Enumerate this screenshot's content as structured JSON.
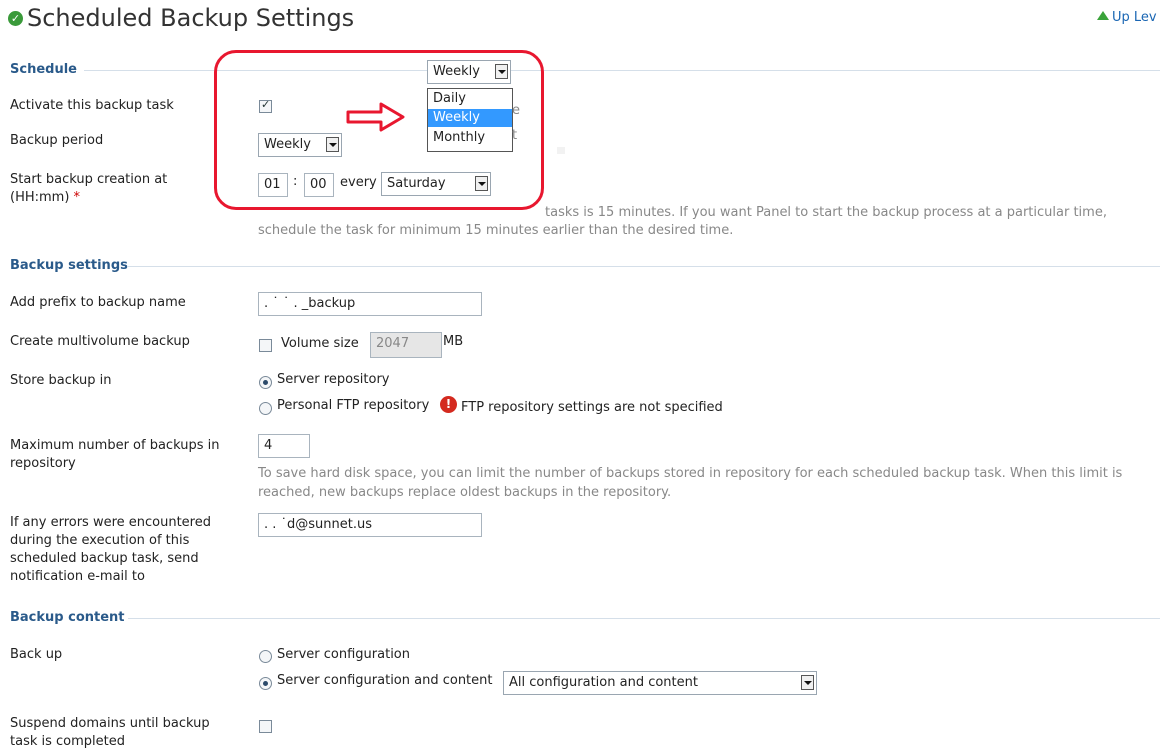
{
  "header": {
    "title": "Scheduled Backup Settings",
    "up_level": "Up Lev"
  },
  "schedule": {
    "section_title": "Schedule",
    "activate_label": "Activate this backup task",
    "activate_checked": true,
    "period_label": "Backup period",
    "period_value": "Weekly",
    "start_label": "Start backup creation at (HH:mm)",
    "required_mark": "*",
    "hour": "01",
    "colon": ":",
    "minute": "00",
    "every_label": "every",
    "day_value": "Saturday",
    "hint": "The check interval for scheduled backup tasks is 15 minutes. If you want Panel to start the backup process at a particular time, schedule the task for minimum 15 minutes earlier than the desired time.",
    "hint_visible": "schedule the task for minimum 15 minutes earlier than the desired time.",
    "hint_partial": "tasks is 15 minutes. If you want Panel to start the backup process at a particular time,"
  },
  "overlay": {
    "select_value": "Weekly",
    "options": [
      "Daily",
      "Weekly",
      "Monthly"
    ],
    "selected_option": "Weekly",
    "obscured_chars": [
      "e",
      "t"
    ],
    "box_color": "#e8172f"
  },
  "backup_settings": {
    "section_title": "Backup settings",
    "prefix_label": "Add prefix to backup name",
    "prefix_value": ". ˙ ˙ . _backup",
    "multivolume_label": "Create multivolume backup",
    "volume_size_label": "Volume size",
    "volume_size_value": "2047",
    "volume_unit": "MB",
    "store_label": "Store backup in",
    "store_options": [
      "Server repository",
      "Personal FTP repository"
    ],
    "store_selected": "Server repository",
    "ftp_warning": "FTP repository settings are not specified",
    "max_label": "Maximum number of backups in repository",
    "max_value": "4",
    "max_hint": "To save hard disk space, you can limit the number of backups stored in repository for each scheduled backup task. When this limit is reached, new backups replace oldest backups in the repository.",
    "email_label": "If any errors were encountered during the execution of this scheduled backup task, send notification e-mail to",
    "email_value": ". . ˙d@sunnet.us"
  },
  "backup_content": {
    "section_title": "Backup content",
    "backup_label": "Back up",
    "options": [
      "Server configuration",
      "Server configuration and content"
    ],
    "selected": "Server configuration and content",
    "content_select": "All configuration and content",
    "suspend_label": "Suspend domains until backup task is completed"
  }
}
